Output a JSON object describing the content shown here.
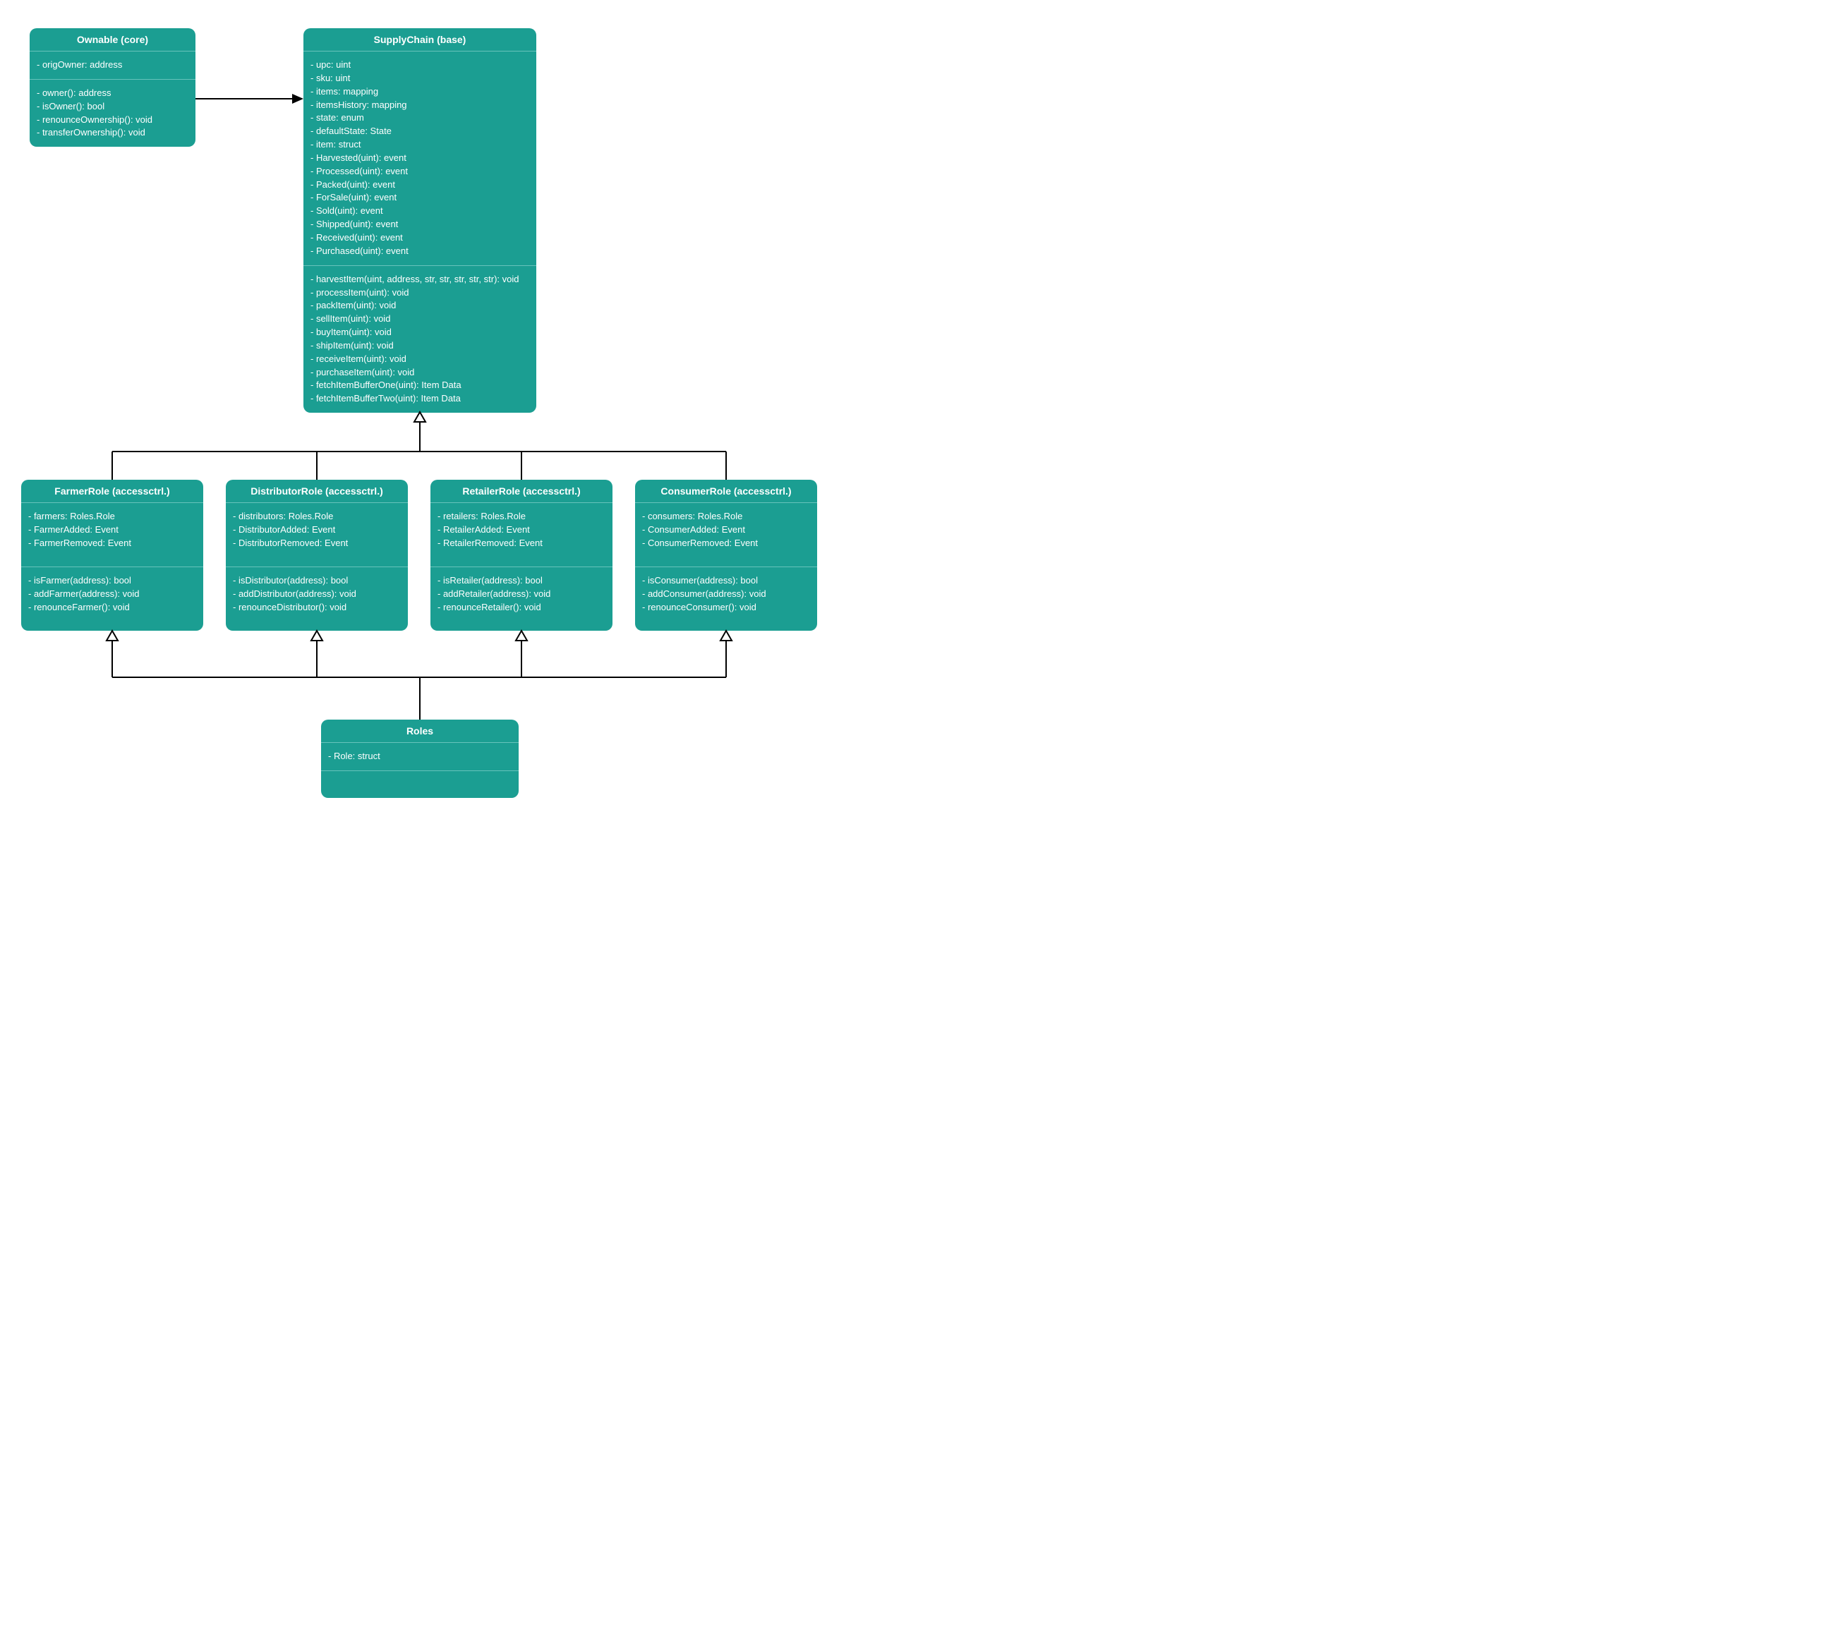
{
  "nodes": {
    "ownable": {
      "title": "Ownable (core)",
      "attrs": [
        "- origOwner: address"
      ],
      "methods": [
        "- owner(): address",
        "- isOwner(): bool",
        "- renounceOwnership(): void",
        "- transferOwnership(): void"
      ]
    },
    "supplychain": {
      "title": "SupplyChain (base)",
      "attrs": [
        "- upc: uint",
        "- sku: uint",
        "- items: mapping",
        "- itemsHistory: mapping",
        "- state: enum",
        "- defaultState: State",
        "- item: struct",
        "- Harvested(uint): event",
        "- Processed(uint): event",
        "- Packed(uint): event",
        "- ForSale(uint): event",
        "- Sold(uint): event",
        "- Shipped(uint): event",
        "- Received(uint): event",
        "- Purchased(uint): event"
      ],
      "methods": [
        "- harvestItem(uint, address, str, str, str, str, str): void",
        "- processItem(uint): void",
        "- packItem(uint): void",
        "- sellItem(uint): void",
        "- buyItem(uint): void",
        "- shipItem(uint): void",
        "- receiveItem(uint): void",
        "- purchaseItem(uint): void",
        "- fetchItemBufferOne(uint): Item Data",
        "- fetchItemBufferTwo(uint): Item Data"
      ]
    },
    "farmer": {
      "title": "FarmerRole (accessctrl.)",
      "attrs": [
        "- farmers: Roles.Role",
        "- FarmerAdded: Event",
        "- FarmerRemoved: Event"
      ],
      "methods": [
        "- isFarmer(address): bool",
        "- addFarmer(address): void",
        "- renounceFarmer(): void"
      ]
    },
    "distributor": {
      "title": "DistributorRole (accessctrl.)",
      "attrs": [
        "- distributors: Roles.Role",
        "- DistributorAdded: Event",
        "- DistributorRemoved: Event"
      ],
      "methods": [
        "- isDistributor(address): bool",
        "- addDistributor(address): void",
        "- renounceDistributor(): void"
      ]
    },
    "retailer": {
      "title": "RetailerRole (accessctrl.)",
      "attrs": [
        "- retailers: Roles.Role",
        "- RetailerAdded: Event",
        "- RetailerRemoved: Event"
      ],
      "methods": [
        "- isRetailer(address): bool",
        "- addRetailer(address): void",
        "- renounceRetailer(): void"
      ]
    },
    "consumer": {
      "title": "ConsumerRole (accessctrl.)",
      "attrs": [
        "- consumers: Roles.Role",
        "- ConsumerAdded: Event",
        "- ConsumerRemoved: Event"
      ],
      "methods": [
        "- isConsumer(address): bool",
        "- addConsumer(address): void",
        "- renounceConsumer(): void"
      ]
    },
    "roles": {
      "title": "Roles",
      "attrs": [
        "- Role: struct"
      ],
      "methods": []
    }
  }
}
